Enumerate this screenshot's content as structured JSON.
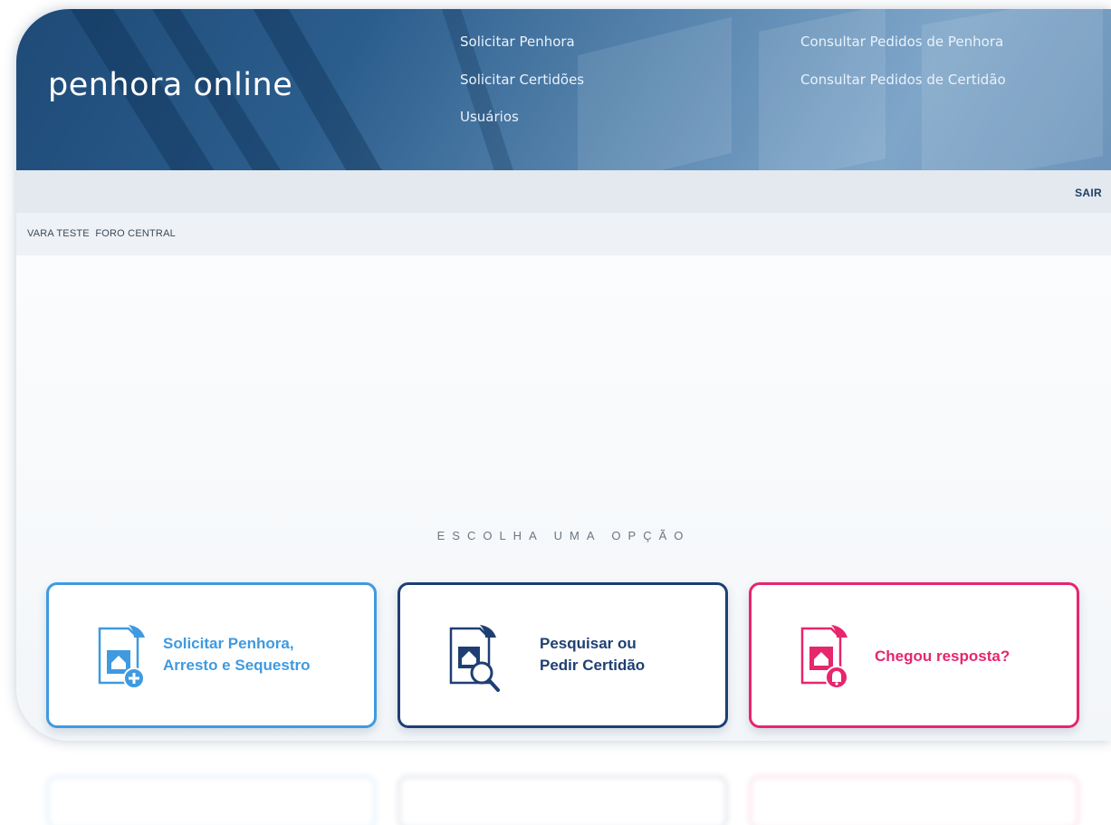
{
  "header": {
    "logo": "penhora online",
    "nav": [
      {
        "label": "Solicitar Penhora"
      },
      {
        "label": "Solicitar Certidões"
      },
      {
        "label": "Usuários"
      },
      {
        "label": "Consultar Pedidos de Penhora"
      },
      {
        "label": "Consultar Pedidos de Certidão"
      }
    ]
  },
  "topbar": {
    "logout_label": "SAIR"
  },
  "court": {
    "name": "VARA TESTE  FORO CENTRAL"
  },
  "main": {
    "prompt": "ESCOLHA UMA OPÇÃO",
    "cards": [
      {
        "line1": "Solicitar Penhora,",
        "line2": "Arresto e Sequestro",
        "color": "#3f9ae0",
        "icon": "document-house-plus-icon"
      },
      {
        "line1": "Pesquisar ou",
        "line2": "Pedir Certidão",
        "color": "#1f3f73",
        "icon": "document-house-search-icon"
      },
      {
        "line1": "Chegou resposta?",
        "color": "#e6266d",
        "icon": "document-house-bell-icon"
      }
    ]
  },
  "colors": {
    "header": "#2b5d8c",
    "subbar": "#e3e9ef"
  }
}
